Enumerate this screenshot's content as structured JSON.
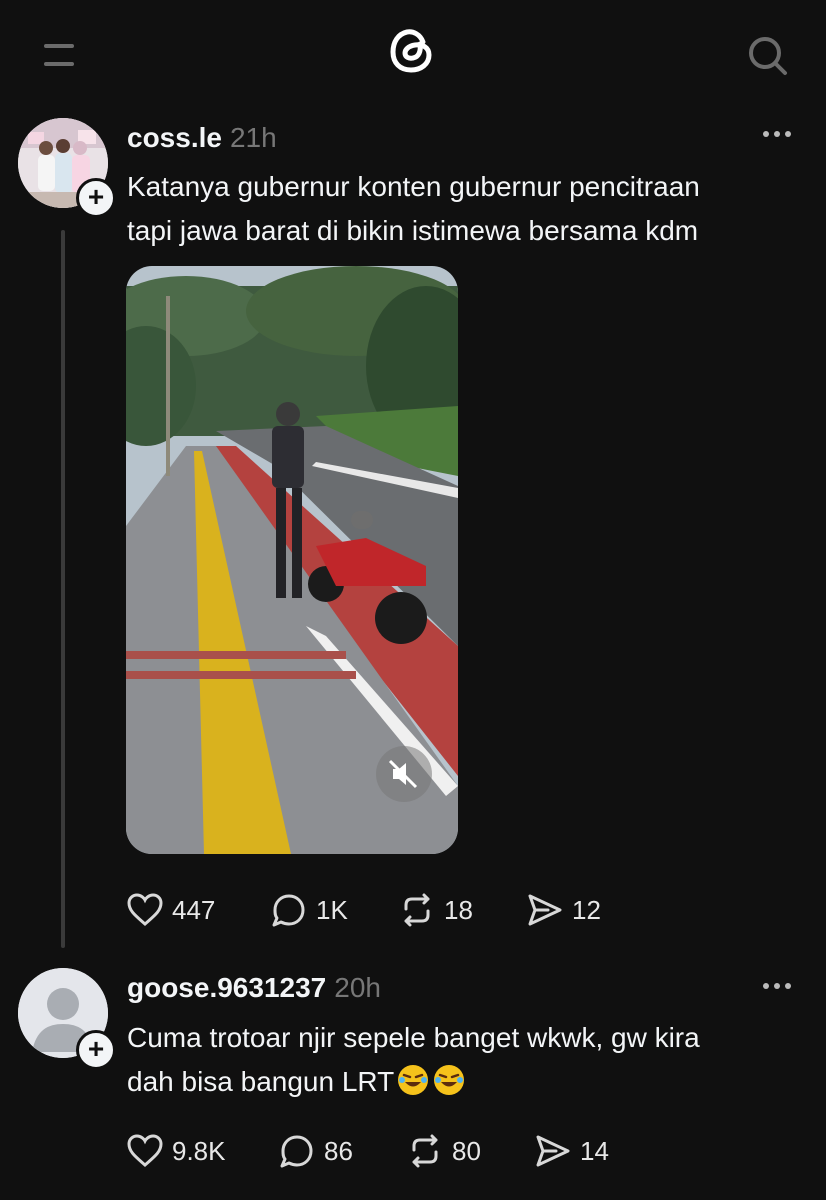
{
  "header": {
    "menu_icon": "hamburger-menu-icon",
    "logo_icon": "threads-logo-icon",
    "search_icon": "search-icon"
  },
  "posts": [
    {
      "username": "coss.le",
      "time": "21h",
      "text_line1": "Katanya gubernur konten gubernur pencitraan",
      "text_line2": "tapi jawa barat di bikin istimewa bersama kdm",
      "media": "video",
      "likes": "447",
      "replies": "1K",
      "reposts": "18",
      "shares": "12"
    },
    {
      "username": "goose.9631237",
      "time": "20h",
      "text_line1": "Cuma trotoar njir sepele banget wkwk, gw kira",
      "text_line2": "dah bisa bangun LRT",
      "emoji": "rolling-on-floor-laughing x2",
      "likes": "9.8K",
      "replies": "86",
      "reposts": "80",
      "shares": "14"
    }
  ],
  "colors": {
    "background": "#101010",
    "text": "#f3f5f7",
    "muted": "#777777",
    "icon": "#6b6b6b"
  }
}
